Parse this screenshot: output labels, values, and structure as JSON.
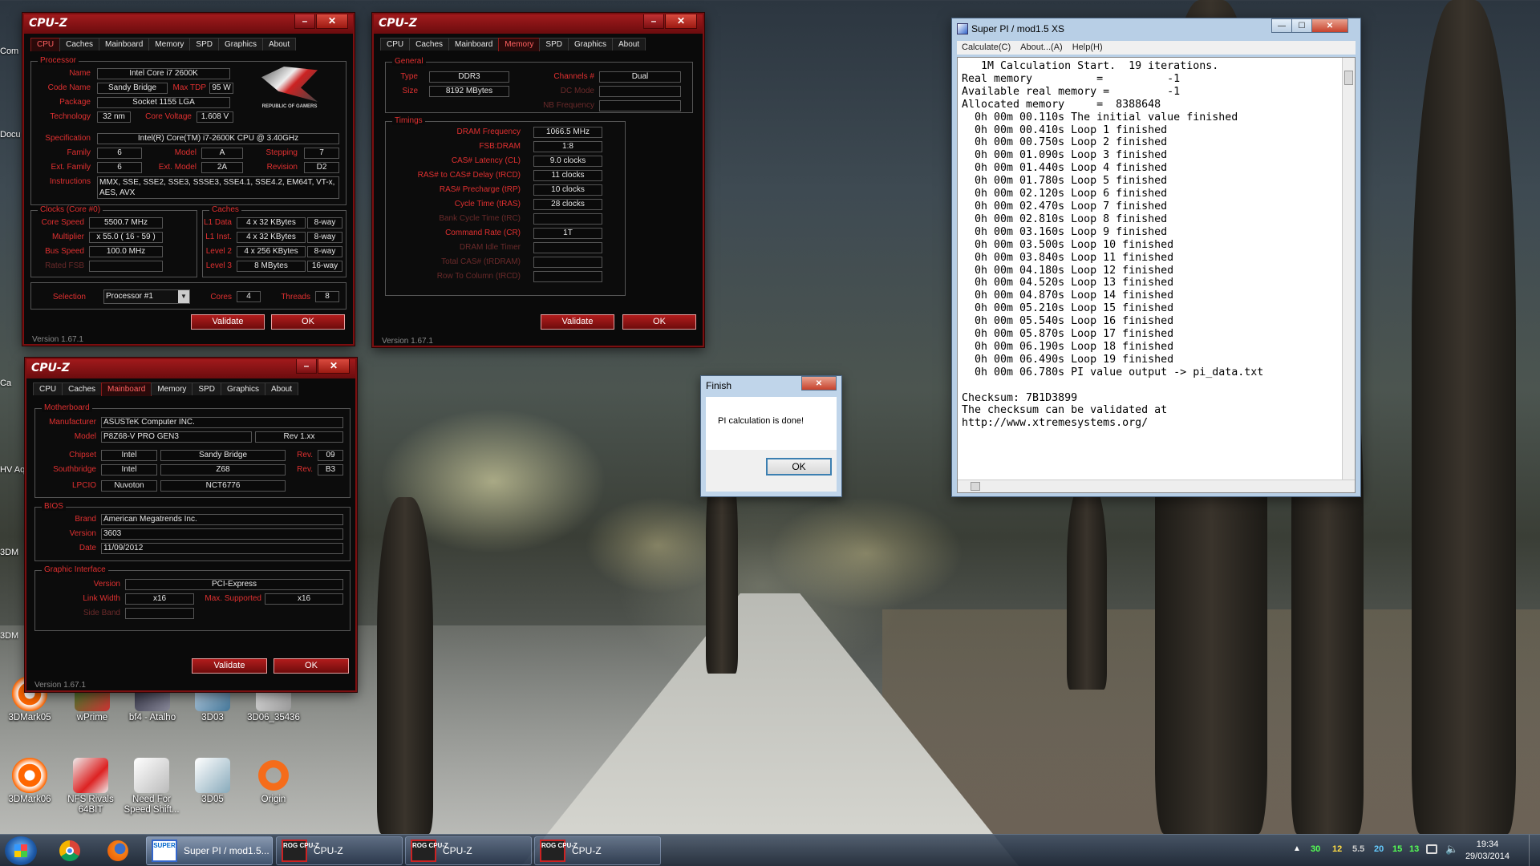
{
  "cpuz1": {
    "logo": "CPU-Z",
    "tabs": [
      "CPU",
      "Caches",
      "Mainboard",
      "Memory",
      "SPD",
      "Graphics",
      "About"
    ],
    "processor_title": "Processor",
    "labels": {
      "name": "Name",
      "codename": "Code Name",
      "maxtdp": "Max TDP",
      "package": "Package",
      "technology": "Technology",
      "corevoltage": "Core Voltage",
      "specification": "Specification",
      "family": "Family",
      "model": "Model",
      "stepping": "Stepping",
      "extfamily": "Ext. Family",
      "extmodel": "Ext. Model",
      "revision": "Revision",
      "instructions": "Instructions"
    },
    "values": {
      "name": "Intel Core i7 2600K",
      "codename": "Sandy Bridge",
      "maxtdp": "95 W",
      "package": "Socket 1155 LGA",
      "technology": "32 nm",
      "corevoltage": "1.608 V",
      "specification": "Intel(R) Core(TM) i7-2600K CPU @ 3.40GHz",
      "family": "6",
      "model": "A",
      "stepping": "7",
      "extfamily": "6",
      "extmodel": "2A",
      "revision": "D2",
      "instructions": "MMX, SSE, SSE2, SSE3, SSSE3, SSE4.1, SSE4.2, EM64T, VT-x, AES, AVX"
    },
    "rog_text": "REPUBLIC OF GAMERS",
    "clocks_title": "Clocks (Core #0)",
    "caches_title": "Caches",
    "clock_labels": [
      "Core Speed",
      "Multiplier",
      "Bus Speed",
      "Rated FSB"
    ],
    "clock_values": [
      "5500.7 MHz",
      "x 55.0 ( 16 - 59 )",
      "100.0 MHz",
      ""
    ],
    "cache_labels": [
      "L1 Data",
      "L1 Inst.",
      "Level 2",
      "Level 3"
    ],
    "cache_sizes": [
      "4 x 32 KBytes",
      "4 x 32 KBytes",
      "4 x 256 KBytes",
      "8 MBytes"
    ],
    "cache_ways": [
      "8-way",
      "8-way",
      "8-way",
      "16-way"
    ],
    "selection_label": "Selection",
    "selection": "Processor #1",
    "cores_label": "Cores",
    "cores": "4",
    "threads_label": "Threads",
    "threads": "8",
    "validate": "Validate",
    "ok": "OK",
    "version": "Version 1.67.1"
  },
  "cpuz2": {
    "logo": "CPU-Z",
    "tabs": [
      "CPU",
      "Caches",
      "Mainboard",
      "Memory",
      "SPD",
      "Graphics",
      "About"
    ],
    "general_title": "General",
    "type_label": "Type",
    "type": "DDR3",
    "size_label": "Size",
    "size": "8192 MBytes",
    "channels_label": "Channels #",
    "channels": "Dual",
    "dcmode_label": "DC Mode",
    "nbfreq_label": "NB Frequency",
    "timings_title": "Timings",
    "timing_labels": [
      "DRAM Frequency",
      "FSB:DRAM",
      "CAS# Latency (CL)",
      "RAS# to CAS# Delay (tRCD)",
      "RAS# Precharge (tRP)",
      "Cycle Time (tRAS)",
      "Bank Cycle Time (tRC)",
      "Command Rate (CR)",
      "DRAM Idle Timer",
      "Total CAS# (tRDRAM)",
      "Row To Column (tRCD)"
    ],
    "timing_values": [
      "1066.5 MHz",
      "1:8",
      "9.0 clocks",
      "11 clocks",
      "10 clocks",
      "28 clocks",
      "",
      "1T",
      "",
      "",
      ""
    ],
    "validate": "Validate",
    "ok": "OK",
    "version": "Version 1.67.1"
  },
  "cpuz3": {
    "logo": "CPU-Z",
    "tabs": [
      "CPU",
      "Caches",
      "Mainboard",
      "Memory",
      "SPD",
      "Graphics",
      "About"
    ],
    "motherboard_title": "Motherboard",
    "manufacturer_label": "Manufacturer",
    "manufacturer": "ASUSTeK Computer INC.",
    "model_label": "Model",
    "model": "P8Z68-V PRO GEN3",
    "model_rev": "Rev 1.xx",
    "chipset_label": "Chipset",
    "chipset_vendor": "Intel",
    "chipset": "Sandy Bridge",
    "chipset_rev_label": "Rev.",
    "chipset_rev": "09",
    "southbridge_label": "Southbridge",
    "sb_vendor": "Intel",
    "sb": "Z68",
    "sb_rev_label": "Rev.",
    "sb_rev": "B3",
    "lpcio_label": "LPCIO",
    "lpcio_vendor": "Nuvoton",
    "lpcio": "NCT6776",
    "bios_title": "BIOS",
    "brand_label": "Brand",
    "brand": "American Megatrends Inc.",
    "version_label": "Version",
    "version": "3603",
    "date_label": "Date",
    "date": "11/09/2012",
    "graphic_title": "Graphic Interface",
    "gi_version_label": "Version",
    "gi_version": "PCI-Express",
    "linkwidth_label": "Link Width",
    "linkwidth": "x16",
    "maxsup_label": "Max. Supported",
    "maxsup": "x16",
    "sideband_label": "Side Band",
    "validate": "Validate",
    "ok": "OK",
    "app_version": "Version 1.67.1"
  },
  "superpi": {
    "title": "Super PI / mod1.5 XS",
    "menu": [
      "Calculate(C)",
      "About...(A)",
      "Help(H)"
    ],
    "output": "   1M Calculation Start.  19 iterations.\nReal memory          =          -1\nAvailable real memory =         -1\nAllocated memory     =  8388648\n  0h 00m 00.110s The initial value finished\n  0h 00m 00.410s Loop 1 finished\n  0h 00m 00.750s Loop 2 finished\n  0h 00m 01.090s Loop 3 finished\n  0h 00m 01.440s Loop 4 finished\n  0h 00m 01.780s Loop 5 finished\n  0h 00m 02.120s Loop 6 finished\n  0h 00m 02.470s Loop 7 finished\n  0h 00m 02.810s Loop 8 finished\n  0h 00m 03.160s Loop 9 finished\n  0h 00m 03.500s Loop 10 finished\n  0h 00m 03.840s Loop 11 finished\n  0h 00m 04.180s Loop 12 finished\n  0h 00m 04.520s Loop 13 finished\n  0h 00m 04.870s Loop 14 finished\n  0h 00m 05.210s Loop 15 finished\n  0h 00m 05.540s Loop 16 finished\n  0h 00m 05.870s Loop 17 finished\n  0h 00m 06.190s Loop 18 finished\n  0h 00m 06.490s Loop 19 finished\n  0h 00m 06.780s PI value output -> pi_data.txt\n\nChecksum: 7B1D3899\nThe checksum can be validated at\nhttp://www.xtremesystems.org/"
  },
  "dialog": {
    "title": "Finish",
    "message": "PI calculation is done!",
    "ok": "OK"
  },
  "desktop": {
    "icons": [
      "3DMark05",
      "wPrime",
      "bf4 - Atalho",
      "3D03",
      "3D06_35436",
      "3DMark06",
      "NFS Rivals 64BIT",
      "Need For Speed Shift...",
      "3D05",
      "Origin"
    ],
    "edge_labels": [
      "Com",
      "Docu",
      "HV Aqu",
      "3DM",
      "3DM",
      "Ca"
    ]
  },
  "taskbar": {
    "items": [
      "Super PI / mod1.5...",
      "CPU-Z",
      "CPU-Z",
      "CPU-Z"
    ],
    "superpi_icon_text": "SUPER",
    "cpuz_icon_text": "ROG CPU-Z",
    "tray_values": [
      "30",
      "12",
      "5.5",
      "20",
      "15",
      "13"
    ],
    "time": "19:34",
    "date": "29/03/2014"
  },
  "colors": {
    "cpuz_accent": "#e03030",
    "cpuz_title": "#a11a1c",
    "win7_frame": "#b8cfe6"
  }
}
